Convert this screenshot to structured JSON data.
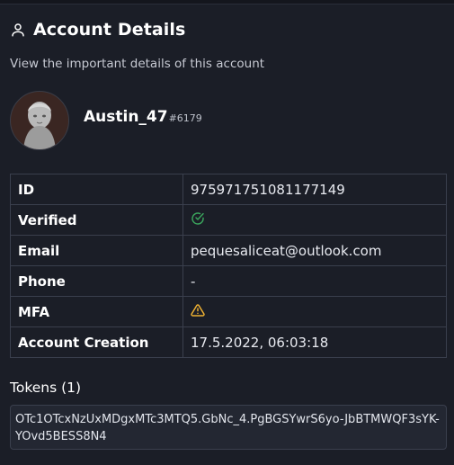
{
  "header": {
    "title": "Account Details",
    "subtitle": "View the important details of this account",
    "icon": "user-icon"
  },
  "profile": {
    "username": "Austin_47",
    "discriminator": "#6179",
    "avatar": "statue-avatar"
  },
  "details": [
    {
      "key": "ID",
      "value": "975971751081177149"
    },
    {
      "key": "Verified",
      "value": "",
      "icon": "check-circle-icon",
      "color": "#3ba55d"
    },
    {
      "key": "Email",
      "value": "pequesaliceat@outlook.com"
    },
    {
      "key": "Phone",
      "value": "-"
    },
    {
      "key": "MFA",
      "value": "",
      "icon": "warning-icon",
      "color": "#f0b232"
    },
    {
      "key": "Account Creation",
      "value": "17.5.2022, 06:03:18"
    }
  ],
  "tokens": {
    "title": "Tokens (1)",
    "items": [
      "OTc1OTcxNzUxMDgxMTc3MTQ5.GbNc_4.PgBGSYwrS6yo-JbBTMWQF3sYK-YOvd5BESS8N4"
    ]
  }
}
